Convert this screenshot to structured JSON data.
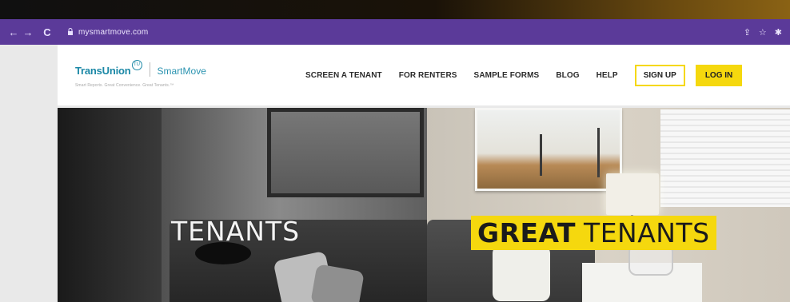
{
  "browser": {
    "url": "mysmartmove.com",
    "back_icon": "←",
    "forward_icon": "→",
    "reload_icon": "C",
    "lock_icon": "🔒",
    "share_icon": "⇪",
    "star_icon": "☆",
    "extension_icon": "✱"
  },
  "header": {
    "logo": {
      "brand": "TransUnion",
      "badge": "TU",
      "product": "SmartMove",
      "tagline": "Smart Reports. Great Convenience. Great Tenants.™"
    },
    "nav": [
      {
        "label": "SCREEN A TENANT"
      },
      {
        "label": "FOR RENTERS"
      },
      {
        "label": "SAMPLE FORMS"
      },
      {
        "label": "BLOG"
      },
      {
        "label": "HELP"
      }
    ],
    "signup_label": "SIGN UP",
    "login_label": "LOG IN"
  },
  "hero": {
    "left_caption": "TENANTS",
    "right_caption_bold": "GREAT",
    "right_caption_rest": "TENANTS"
  },
  "colors": {
    "browser_bar": "#5b3a99",
    "accent_yellow": "#f5d80e",
    "brand_teal": "#1b88a6"
  }
}
